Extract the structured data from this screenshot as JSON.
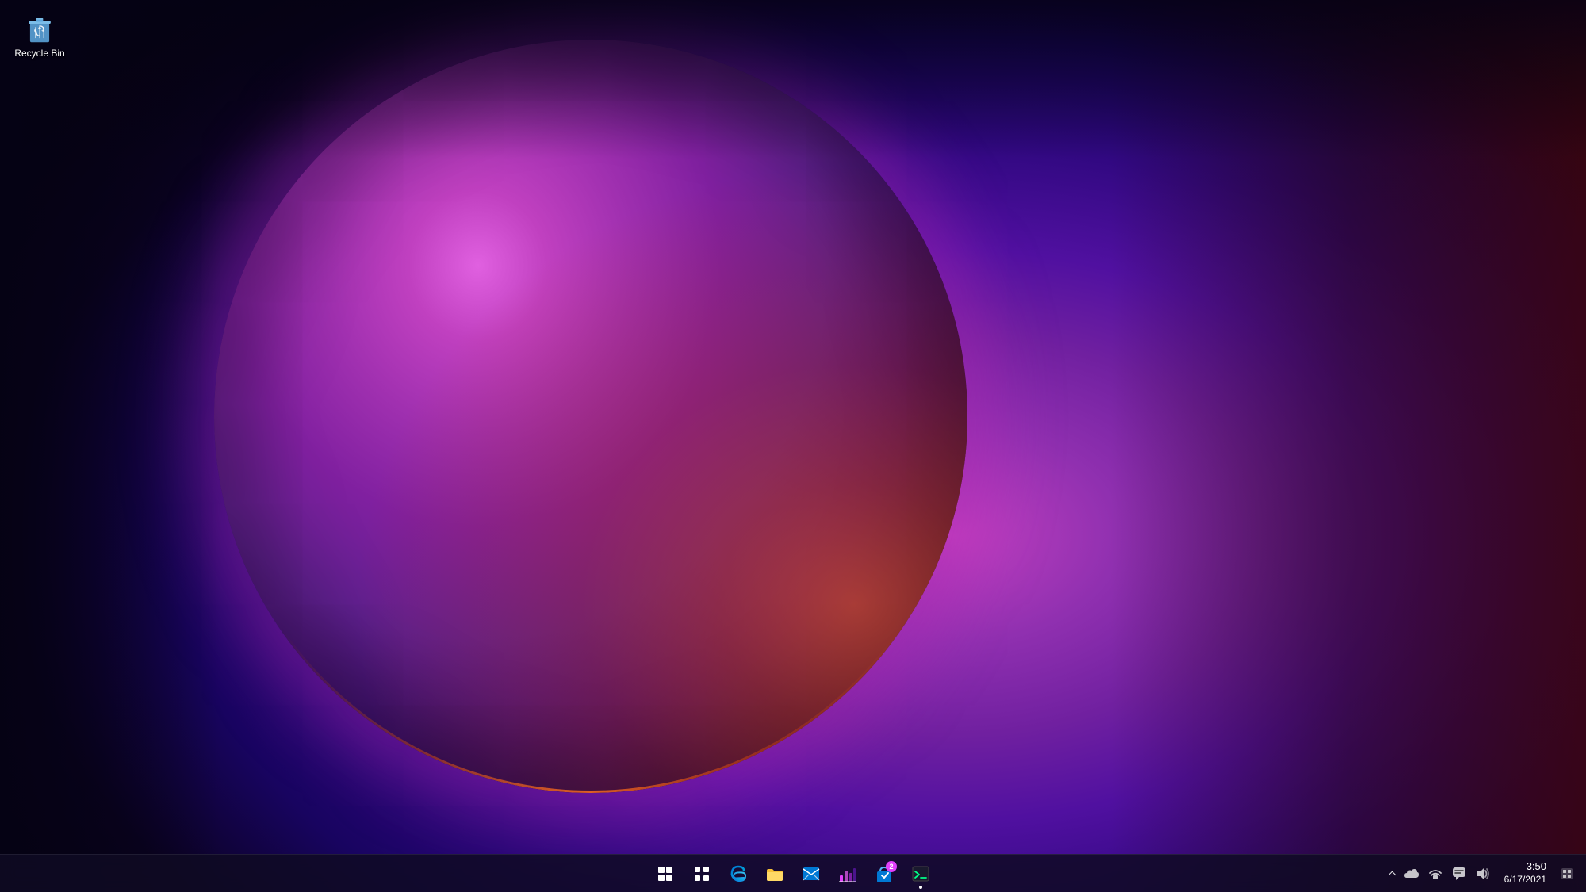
{
  "desktop": {
    "icons": [
      {
        "id": "recycle-bin",
        "label": "Recycle Bin",
        "type": "recycle-bin"
      }
    ]
  },
  "taskbar": {
    "center_icons": [
      {
        "id": "start",
        "label": "Start",
        "type": "windows-logo"
      },
      {
        "id": "search",
        "label": "Search",
        "type": "search-grid"
      },
      {
        "id": "edge",
        "label": "Microsoft Edge",
        "type": "edge"
      },
      {
        "id": "explorer",
        "label": "File Explorer",
        "type": "folder"
      },
      {
        "id": "mail",
        "label": "Mail",
        "type": "mail"
      },
      {
        "id": "photos",
        "label": "MSI Center",
        "type": "chart"
      },
      {
        "id": "store",
        "label": "App with badge",
        "type": "store",
        "badge": "2"
      },
      {
        "id": "terminal",
        "label": "Terminal",
        "type": "terminal",
        "dot": true
      }
    ],
    "tray": {
      "icons": [
        {
          "id": "chevron-up",
          "label": "Show hidden icons"
        },
        {
          "id": "cloud",
          "label": "OneDrive"
        },
        {
          "id": "network",
          "label": "Network"
        },
        {
          "id": "chat",
          "label": "Chat"
        },
        {
          "id": "volume",
          "label": "Volume"
        }
      ],
      "clock": {
        "time": "3:50",
        "date": "6/17/2021"
      }
    }
  }
}
